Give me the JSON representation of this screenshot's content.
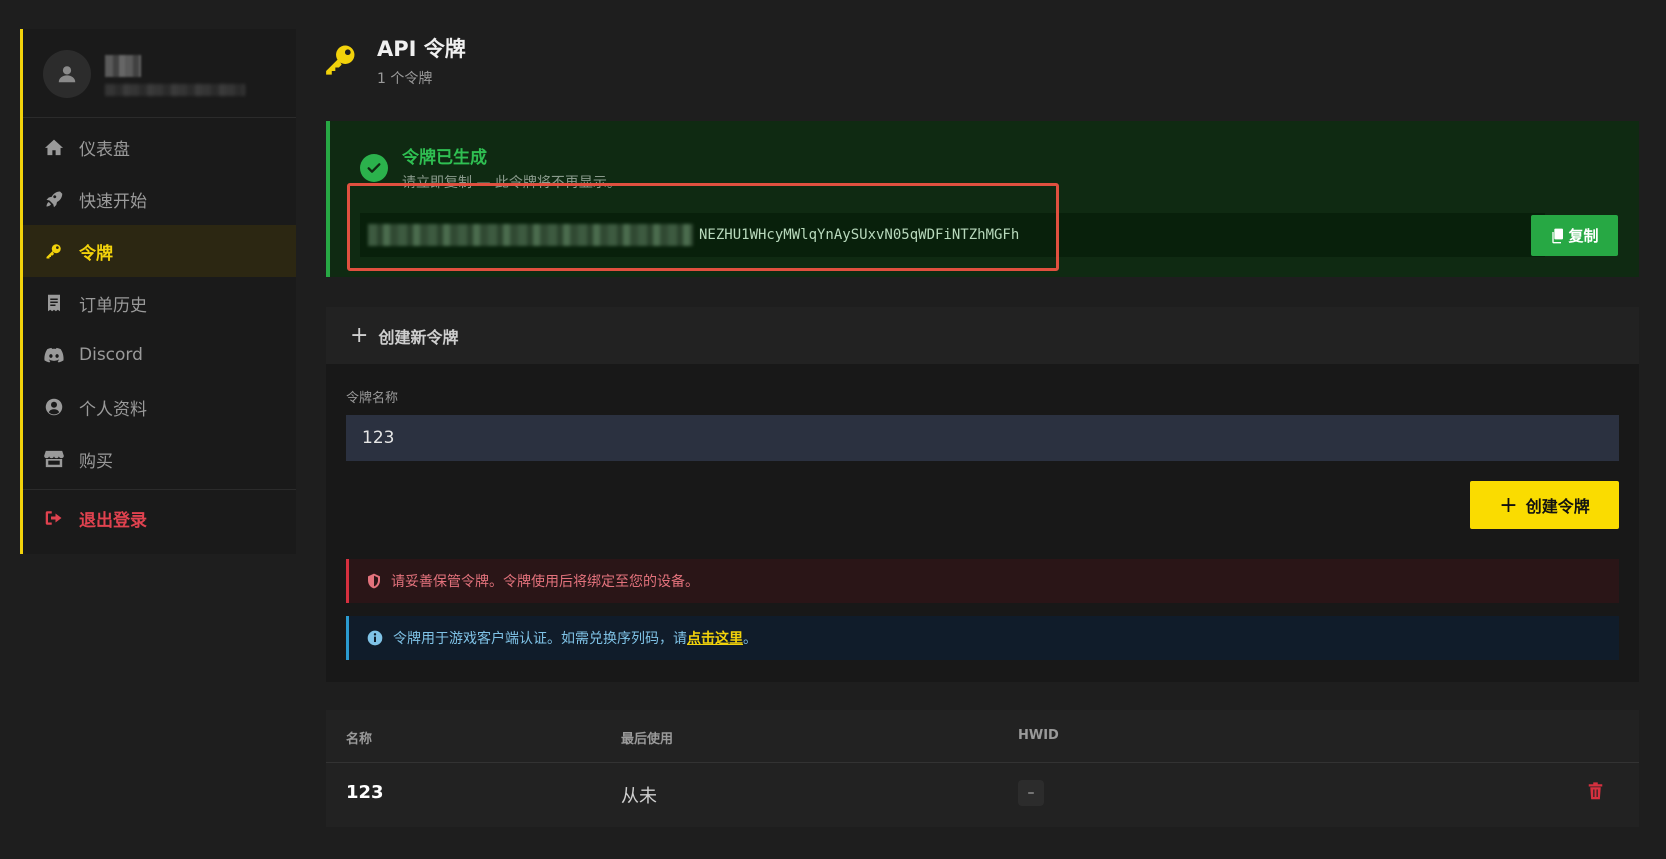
{
  "sidebar": {
    "items": [
      {
        "label": "仪表盘",
        "icon": "home-icon"
      },
      {
        "label": "快速开始",
        "icon": "rocket-icon"
      },
      {
        "label": "令牌",
        "icon": "key-icon",
        "active": true
      },
      {
        "label": "订单历史",
        "icon": "receipt-icon"
      },
      {
        "label": "Discord",
        "icon": "discord-icon"
      },
      {
        "label": "个人资料",
        "icon": "user-circle-icon"
      },
      {
        "label": "购买",
        "icon": "store-icon"
      }
    ],
    "logout_label": "退出登录"
  },
  "page": {
    "title": "API 令牌",
    "subtitle": "1 个令牌"
  },
  "success": {
    "title": "令牌已生成",
    "message": "请立即复制 — 此令牌将不再显示。",
    "token_visible_suffix": "NEZHU1WHcyMWlqYnAySUxvN05qWDFiNTZhMGFh",
    "copy_label": "复制"
  },
  "create": {
    "header": "创建新令牌",
    "field_label": "令牌名称",
    "field_value": "123",
    "button_label": "创建令牌"
  },
  "alerts": {
    "danger": "请妥善保管令牌。令牌使用后将绑定至您的设备。",
    "info_prefix": "令牌用于游戏客户端认证。如需兑换序列码，请",
    "info_link": "点击这里",
    "info_suffix": "。"
  },
  "table": {
    "headers": {
      "name": "名称",
      "last_used": "最后使用",
      "hwid": "HWID"
    },
    "rows": [
      {
        "name": "123",
        "last_used": "从未",
        "hwid": "–"
      }
    ]
  },
  "colors": {
    "accent": "#f2d20b",
    "success": "#27a844",
    "danger": "#d6303f",
    "info": "#2b9bd0",
    "highlight_outline": "#e0503f"
  }
}
